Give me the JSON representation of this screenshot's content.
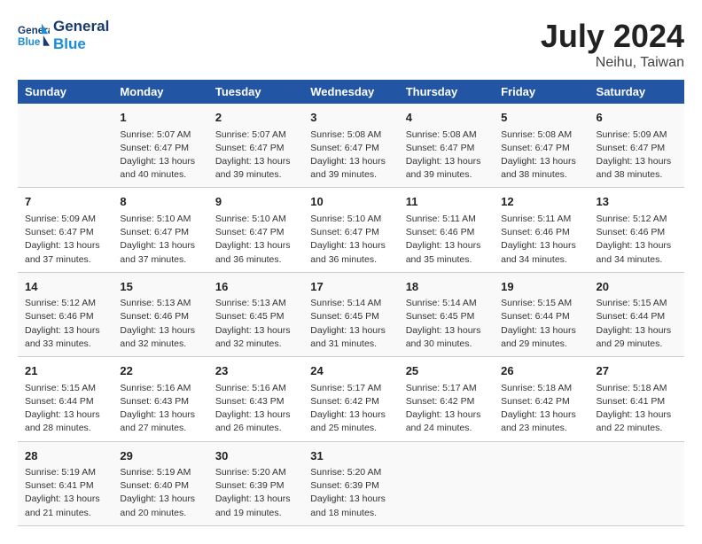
{
  "header": {
    "logo_line1": "General",
    "logo_line2": "Blue",
    "month_year": "July 2024",
    "location": "Neihu, Taiwan"
  },
  "columns": [
    "Sunday",
    "Monday",
    "Tuesday",
    "Wednesday",
    "Thursday",
    "Friday",
    "Saturday"
  ],
  "weeks": [
    [
      {
        "day": "",
        "info": ""
      },
      {
        "day": "1",
        "info": "Sunrise: 5:07 AM\nSunset: 6:47 PM\nDaylight: 13 hours\nand 40 minutes."
      },
      {
        "day": "2",
        "info": "Sunrise: 5:07 AM\nSunset: 6:47 PM\nDaylight: 13 hours\nand 39 minutes."
      },
      {
        "day": "3",
        "info": "Sunrise: 5:08 AM\nSunset: 6:47 PM\nDaylight: 13 hours\nand 39 minutes."
      },
      {
        "day": "4",
        "info": "Sunrise: 5:08 AM\nSunset: 6:47 PM\nDaylight: 13 hours\nand 39 minutes."
      },
      {
        "day": "5",
        "info": "Sunrise: 5:08 AM\nSunset: 6:47 PM\nDaylight: 13 hours\nand 38 minutes."
      },
      {
        "day": "6",
        "info": "Sunrise: 5:09 AM\nSunset: 6:47 PM\nDaylight: 13 hours\nand 38 minutes."
      }
    ],
    [
      {
        "day": "7",
        "info": "Sunrise: 5:09 AM\nSunset: 6:47 PM\nDaylight: 13 hours\nand 37 minutes."
      },
      {
        "day": "8",
        "info": "Sunrise: 5:10 AM\nSunset: 6:47 PM\nDaylight: 13 hours\nand 37 minutes."
      },
      {
        "day": "9",
        "info": "Sunrise: 5:10 AM\nSunset: 6:47 PM\nDaylight: 13 hours\nand 36 minutes."
      },
      {
        "day": "10",
        "info": "Sunrise: 5:10 AM\nSunset: 6:47 PM\nDaylight: 13 hours\nand 36 minutes."
      },
      {
        "day": "11",
        "info": "Sunrise: 5:11 AM\nSunset: 6:46 PM\nDaylight: 13 hours\nand 35 minutes."
      },
      {
        "day": "12",
        "info": "Sunrise: 5:11 AM\nSunset: 6:46 PM\nDaylight: 13 hours\nand 34 minutes."
      },
      {
        "day": "13",
        "info": "Sunrise: 5:12 AM\nSunset: 6:46 PM\nDaylight: 13 hours\nand 34 minutes."
      }
    ],
    [
      {
        "day": "14",
        "info": "Sunrise: 5:12 AM\nSunset: 6:46 PM\nDaylight: 13 hours\nand 33 minutes."
      },
      {
        "day": "15",
        "info": "Sunrise: 5:13 AM\nSunset: 6:46 PM\nDaylight: 13 hours\nand 32 minutes."
      },
      {
        "day": "16",
        "info": "Sunrise: 5:13 AM\nSunset: 6:45 PM\nDaylight: 13 hours\nand 32 minutes."
      },
      {
        "day": "17",
        "info": "Sunrise: 5:14 AM\nSunset: 6:45 PM\nDaylight: 13 hours\nand 31 minutes."
      },
      {
        "day": "18",
        "info": "Sunrise: 5:14 AM\nSunset: 6:45 PM\nDaylight: 13 hours\nand 30 minutes."
      },
      {
        "day": "19",
        "info": "Sunrise: 5:15 AM\nSunset: 6:44 PM\nDaylight: 13 hours\nand 29 minutes."
      },
      {
        "day": "20",
        "info": "Sunrise: 5:15 AM\nSunset: 6:44 PM\nDaylight: 13 hours\nand 29 minutes."
      }
    ],
    [
      {
        "day": "21",
        "info": "Sunrise: 5:15 AM\nSunset: 6:44 PM\nDaylight: 13 hours\nand 28 minutes."
      },
      {
        "day": "22",
        "info": "Sunrise: 5:16 AM\nSunset: 6:43 PM\nDaylight: 13 hours\nand 27 minutes."
      },
      {
        "day": "23",
        "info": "Sunrise: 5:16 AM\nSunset: 6:43 PM\nDaylight: 13 hours\nand 26 minutes."
      },
      {
        "day": "24",
        "info": "Sunrise: 5:17 AM\nSunset: 6:42 PM\nDaylight: 13 hours\nand 25 minutes."
      },
      {
        "day": "25",
        "info": "Sunrise: 5:17 AM\nSunset: 6:42 PM\nDaylight: 13 hours\nand 24 minutes."
      },
      {
        "day": "26",
        "info": "Sunrise: 5:18 AM\nSunset: 6:42 PM\nDaylight: 13 hours\nand 23 minutes."
      },
      {
        "day": "27",
        "info": "Sunrise: 5:18 AM\nSunset: 6:41 PM\nDaylight: 13 hours\nand 22 minutes."
      }
    ],
    [
      {
        "day": "28",
        "info": "Sunrise: 5:19 AM\nSunset: 6:41 PM\nDaylight: 13 hours\nand 21 minutes."
      },
      {
        "day": "29",
        "info": "Sunrise: 5:19 AM\nSunset: 6:40 PM\nDaylight: 13 hours\nand 20 minutes."
      },
      {
        "day": "30",
        "info": "Sunrise: 5:20 AM\nSunset: 6:39 PM\nDaylight: 13 hours\nand 19 minutes."
      },
      {
        "day": "31",
        "info": "Sunrise: 5:20 AM\nSunset: 6:39 PM\nDaylight: 13 hours\nand 18 minutes."
      },
      {
        "day": "",
        "info": ""
      },
      {
        "day": "",
        "info": ""
      },
      {
        "day": "",
        "info": ""
      }
    ]
  ]
}
